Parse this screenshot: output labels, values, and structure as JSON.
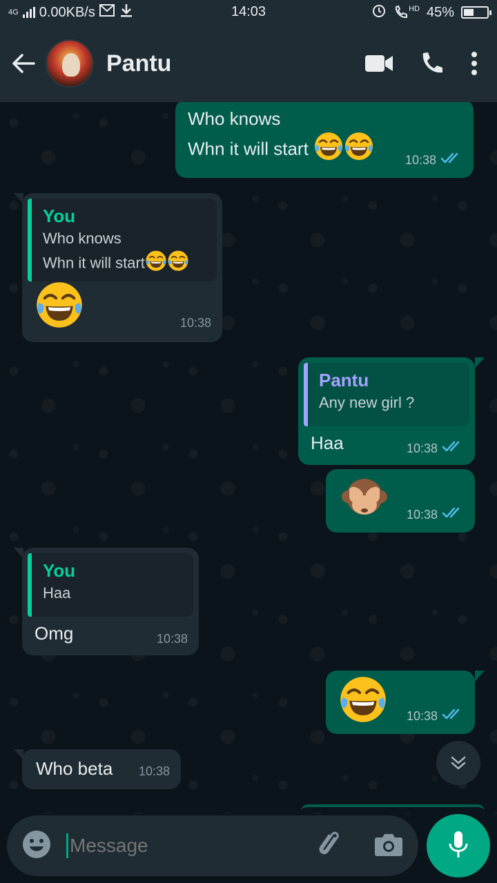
{
  "status_bar": {
    "network": "4G",
    "speed": "0.00KB/s",
    "time": "14:03",
    "hd": "HD",
    "battery": "45%",
    "battery_level": 0.45
  },
  "header": {
    "contact_name": "Pantu"
  },
  "messages": [
    {
      "dir": "out",
      "lines": [
        "Who knows",
        "Whn it will start"
      ],
      "time": "10:38"
    },
    {
      "dir": "in",
      "quote_author": "You",
      "quote_lines": [
        "Who knows",
        "Whn it will start"
      ],
      "time": "10:38"
    },
    {
      "dir": "out",
      "quote_author": "Pantu",
      "quote_lines": [
        "Any new girl ?"
      ],
      "text": "Haa",
      "time": "10:38"
    },
    {
      "dir": "out",
      "time": "10:38"
    },
    {
      "dir": "in",
      "quote_author": "You",
      "quote_lines": [
        "Haa"
      ],
      "text": "Omg",
      "time": "10:38"
    },
    {
      "dir": "out",
      "time": "10:38"
    },
    {
      "dir": "in",
      "text": "Who beta",
      "time": "10:38"
    }
  ],
  "input": {
    "placeholder": "Message"
  },
  "colors": {
    "outgoing_bubble": "#005c4b",
    "incoming_bubble": "#1f2c34",
    "accent": "#00a884",
    "read_tick": "#53bdeb"
  }
}
